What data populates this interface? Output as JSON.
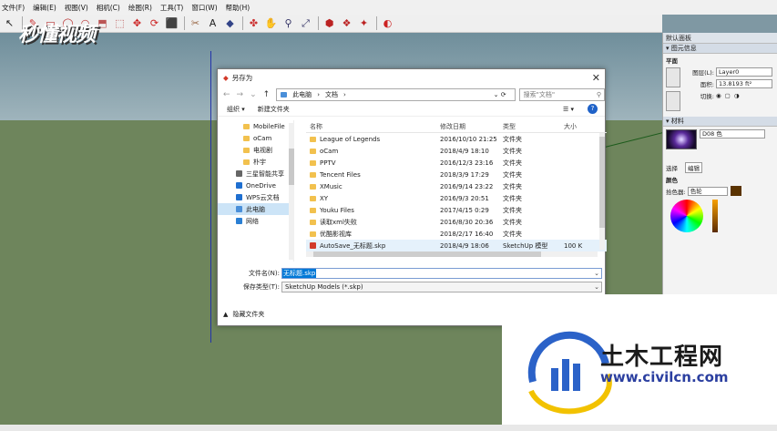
{
  "menubar": [
    "文件(F)",
    "编辑(E)",
    "视图(V)",
    "相机(C)",
    "绘图(R)",
    "工具(T)",
    "窗口(W)",
    "帮助(H)"
  ],
  "watermark": "秒懂视频",
  "right_panel": {
    "title": "默认面板",
    "entity_section": "图元信息",
    "face_label": "平面",
    "layer_label": "图层(L):",
    "layer_value": "Layer0",
    "area_label": "面积:",
    "area_value": "13.8193 ft²",
    "toggle_label": "切换:",
    "materials_section": "材料",
    "material_name": "D08 色",
    "tab_select": "选择",
    "tab_edit": "编辑",
    "color_label": "颜色",
    "picker_label": "拾色器:",
    "picker_value": "色轮"
  },
  "dialog": {
    "title": "另存为",
    "breadcrumb": [
      "此电脑",
      "›",
      "文档",
      "›"
    ],
    "search_placeholder": "搜索\"文档\"",
    "organize": "组织 ▾",
    "new_folder": "新建文件夹",
    "nav_items": [
      {
        "label": "MobileFile",
        "kind": "folder",
        "sub": true
      },
      {
        "label": "oCam",
        "kind": "folder",
        "sub": true
      },
      {
        "label": "电视剧",
        "kind": "folder",
        "sub": true
      },
      {
        "label": "朴宇",
        "kind": "folder",
        "sub": true
      },
      {
        "label": "三星智能共享",
        "kind": "device",
        "sub": false
      },
      {
        "label": "OneDrive",
        "kind": "cloud",
        "sub": false
      },
      {
        "label": "WPS云文档",
        "kind": "cloud",
        "sub": false
      },
      {
        "label": "此电脑",
        "kind": "pc",
        "sub": false,
        "selected": true
      },
      {
        "label": "网络",
        "kind": "net",
        "sub": false
      }
    ],
    "columns": {
      "name": "名称",
      "date": "修改日期",
      "type": "类型",
      "size": "大小"
    },
    "files": [
      {
        "name": "League of Legends",
        "date": "2016/10/10 21:25",
        "type": "文件夹",
        "size": ""
      },
      {
        "name": "oCam",
        "date": "2018/4/9 18:10",
        "type": "文件夹",
        "size": ""
      },
      {
        "name": "PPTV",
        "date": "2016/12/3 23:16",
        "type": "文件夹",
        "size": ""
      },
      {
        "name": "Tencent Files",
        "date": "2018/3/9 17:29",
        "type": "文件夹",
        "size": ""
      },
      {
        "name": "XMusic",
        "date": "2016/9/14 23:22",
        "type": "文件夹",
        "size": ""
      },
      {
        "name": "XY",
        "date": "2016/9/3 20:51",
        "type": "文件夹",
        "size": ""
      },
      {
        "name": "Youku Files",
        "date": "2017/4/15 0:29",
        "type": "文件夹",
        "size": ""
      },
      {
        "name": "读取xml失败",
        "date": "2016/8/30 20:36",
        "type": "文件夹",
        "size": ""
      },
      {
        "name": "优酷影视库",
        "date": "2018/2/17 16:40",
        "type": "文件夹",
        "size": ""
      },
      {
        "name": "AutoSave_无标题.skp",
        "date": "2018/4/9 18:06",
        "type": "SketchUp 模型",
        "size": "100 K",
        "selected": true
      }
    ],
    "filename_label": "文件名(N):",
    "filename_value": "无标题.skp",
    "filetype_label": "保存类型(T):",
    "filetype_value": "SketchUp Models (*.skp)",
    "hide_folders": "隐藏文件夹"
  },
  "logo": {
    "text": "土木工程网",
    "url": "www.civilcn.com"
  },
  "colors": {
    "accent": "#0078d7",
    "ground": "#6e855c",
    "sky": "#8ba4ae"
  }
}
